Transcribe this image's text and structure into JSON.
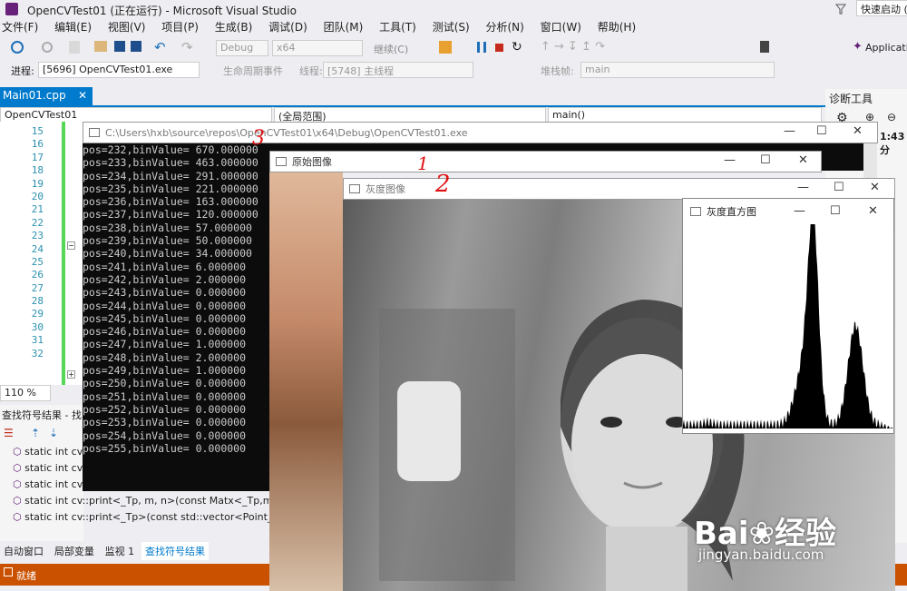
{
  "window": {
    "title": "OpenCVTest01 (正在运行) - Microsoft Visual Studio",
    "quick_launch": "快速启动 (Ctrl"
  },
  "menu": [
    "文件(F)",
    "编辑(E)",
    "视图(V)",
    "项目(P)",
    "生成(B)",
    "调试(D)",
    "团队(M)",
    "工具(T)",
    "测试(S)",
    "分析(N)",
    "窗口(W)",
    "帮助(H)"
  ],
  "toolbar": {
    "config": "Debug",
    "platform": "x64",
    "continue": "继续(C)",
    "application": "Applicatio"
  },
  "toolbar2": {
    "process_label": "进程:",
    "process": "[5696] OpenCVTest01.exe",
    "lifecycle": "生命周期事件",
    "thread_label": "线程:",
    "thread": "[5748] 主线程",
    "stack_label": "堆栈帧:",
    "stack": "main"
  },
  "editor": {
    "tab": "Main01.cpp",
    "scope_project": "OpenCVTest01",
    "scope_global": "(全局范围)",
    "scope_func": "main()",
    "zoom": "110 %",
    "line_numbers": [
      "15",
      "16",
      "17",
      "18",
      "19",
      "20",
      "21",
      "22",
      "23",
      "24",
      "25",
      "26",
      "27",
      "28",
      "29",
      "30",
      "31",
      "32"
    ]
  },
  "diagnostics": {
    "title": "诊断工具",
    "time": "1:43 分"
  },
  "console": {
    "title": "C:\\Users\\hxb\\source\\repos\\OpenCVTest01\\x64\\Debug\\OpenCVTest01.exe",
    "lines": [
      "pos=232,binValue= 670.000000",
      "pos=233,binValue= 463.000000",
      "pos=234,binValue= 291.000000",
      "pos=235,binValue= 221.000000",
      "pos=236,binValue= 163.000000",
      "pos=237,binValue= 120.000000",
      "pos=238,binValue= 57.000000",
      "pos=239,binValue= 50.000000",
      "pos=240,binValue= 34.000000",
      "pos=241,binValue= 6.000000",
      "pos=242,binValue= 2.000000",
      "pos=243,binValue= 0.000000",
      "pos=244,binValue= 0.000000",
      "pos=245,binValue= 0.000000",
      "pos=246,binValue= 0.000000",
      "pos=247,binValue= 1.000000",
      "pos=248,binValue= 2.000000",
      "pos=249,binValue= 1.000000",
      "pos=250,binValue= 0.000000",
      "pos=251,binValue= 0.000000",
      "pos=252,binValue= 0.000000",
      "pos=253,binValue= 0.000000",
      "pos=254,binValue= 0.000000",
      "pos=255,binValue= 0.000000"
    ]
  },
  "windows": {
    "original": "原始图像",
    "gray": "灰度图像",
    "hist": "灰度直方图"
  },
  "annotations": {
    "a1": "1",
    "a2": "2",
    "a3": "3"
  },
  "find_results": {
    "title": "查找符号结果 - 找",
    "items": [
      "static int cv",
      "static int cv",
      "static int cv",
      "static int cv::print<_Tp, m, n>(const Matx<_Tp,m,n>",
      "static int cv::print<_Tp>(const std::vector<Point_<_T"
    ]
  },
  "bottom_tabs": [
    "自动窗口",
    "局部变量",
    "监视 1",
    "查找符号结果"
  ],
  "status": {
    "text": "就绪"
  },
  "watermark": {
    "brand": "Bai",
    "brand2": "经验",
    "url": "jingyan.baidu.com"
  },
  "colors": {
    "statusbar": "#ca5100",
    "vs_purple": "#68217a",
    "tab_blue": "#007acc"
  }
}
